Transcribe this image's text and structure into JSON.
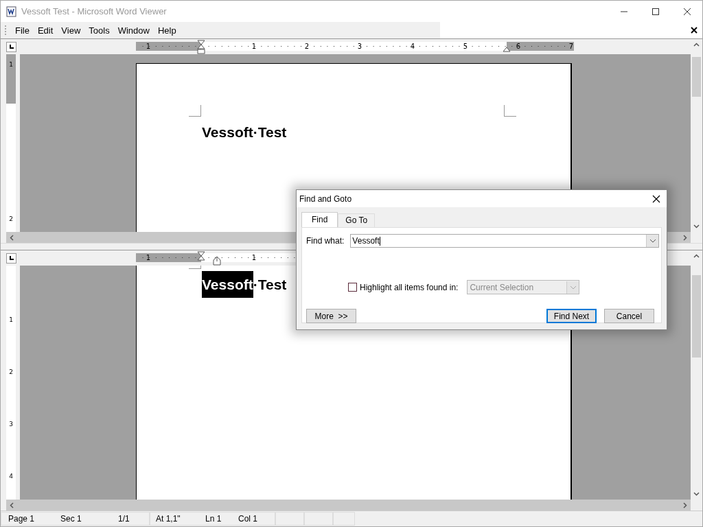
{
  "window": {
    "title": "Vessoft Test - Microsoft Word Viewer"
  },
  "menu": [
    "File",
    "Edit",
    "View",
    "Tools",
    "Window",
    "Help"
  ],
  "panes": [
    {
      "ruler_numbers": [
        "1",
        "1",
        "2",
        "3",
        "4",
        "5",
        "6",
        "7"
      ],
      "vertical_ruler_numbers": [
        "1",
        "2"
      ],
      "heading": [
        {
          "text": "Vessoft·Test",
          "selected": false
        }
      ]
    },
    {
      "ruler_numbers": [
        "1",
        "1"
      ],
      "vertical_ruler_numbers": [
        "1",
        "2",
        "3",
        "4"
      ],
      "heading": [
        {
          "text": "Vessoft",
          "selected": true
        },
        {
          "text": "·Test",
          "selected": false
        }
      ]
    }
  ],
  "dialog": {
    "title": "Find and Goto",
    "tabs": [
      {
        "label": "Find",
        "selected": true
      },
      {
        "label": "Go To",
        "selected": false
      }
    ],
    "find_label": "Find what:",
    "find_value": "Vessoft",
    "highlight": {
      "label": "Highlight all items found in:",
      "checked": false
    },
    "scope": {
      "value": "Current Selection",
      "disabled": true
    },
    "buttons": [
      {
        "label": "More  >>",
        "default": false
      },
      {
        "label": "Find Next",
        "default": true
      },
      {
        "label": "Cancel",
        "default": false
      }
    ]
  },
  "status_bar": [
    "Page 1",
    "Sec 1",
    "1/1",
    "At 1,1\"",
    "Ln 1",
    "Col 1"
  ]
}
